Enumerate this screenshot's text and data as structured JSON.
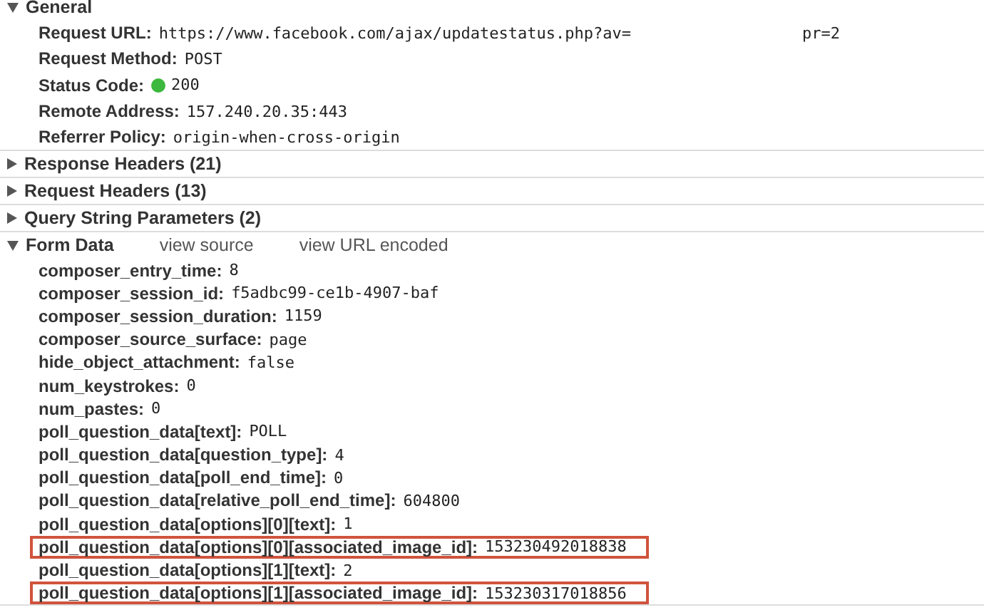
{
  "sections": [
    {
      "title": "General",
      "expanded": true,
      "rows": [
        {
          "label": "Request URL:",
          "value": "https://www.facebook.com/ajax/updatestatus.php?av=",
          "value_2": "pr=2"
        },
        {
          "label": "Request Method:",
          "value": "POST"
        },
        {
          "label": "Status Code:",
          "value": "200",
          "color": "#3cb83c"
        },
        {
          "label": "Remote Address:",
          "value": "157.240.20.35:443"
        },
        {
          "label": "Referrer Policy:",
          "value": "origin-when-cross-origin"
        }
      ]
    },
    {
      "title": "Response Headers (21)",
      "expanded": false
    },
    {
      "title": "Request Headers (13)",
      "expanded": false
    },
    {
      "title": "Query String Parameters (2)",
      "expanded": false
    },
    {
      "title": "Form Data",
      "expanded": true,
      "links": [
        "view source",
        "view URL encoded"
      ],
      "rows": [
        {
          "label": "composer_entry_time:",
          "value": "8",
          "highlighted": false
        },
        {
          "label": "composer_session_id:",
          "value": "f5adbc99-ce1b-4907-baf",
          "highlighted": false
        },
        {
          "label": "composer_session_duration:",
          "value": "1159",
          "highlighted": false
        },
        {
          "label": "composer_source_surface:",
          "value": "page",
          "highlighted": false
        },
        {
          "label": "hide_object_attachment:",
          "value": "false",
          "highlighted": false
        },
        {
          "label": "num_keystrokes:",
          "value": "0",
          "highlighted": false
        },
        {
          "label": "num_pastes:",
          "value": "0",
          "highlighted": false
        },
        {
          "label": "poll_question_data[text]:",
          "value": "POLL",
          "highlighted": false
        },
        {
          "label": "poll_question_data[question_type]:",
          "value": "4",
          "highlighted": false
        },
        {
          "label": "poll_question_data[poll_end_time]:",
          "value": "0",
          "highlighted": false
        },
        {
          "label": "poll_question_data[relative_poll_end_time]:",
          "value": "604800",
          "highlighted": false
        },
        {
          "label": "poll_question_data[options][0][text]:",
          "value": "1",
          "highlighted": false
        },
        {
          "label": "poll_question_data[options][0][associated_image_id]:",
          "value": "153230492018838",
          "highlighted": true
        },
        {
          "label": "poll_question_data[options][1][text]:",
          "value": "2",
          "highlighted": false
        },
        {
          "label": "poll_question_data[options][1][associated_image_id]:",
          "value": "153230317018856",
          "highlighted": true
        }
      ]
    }
  ]
}
